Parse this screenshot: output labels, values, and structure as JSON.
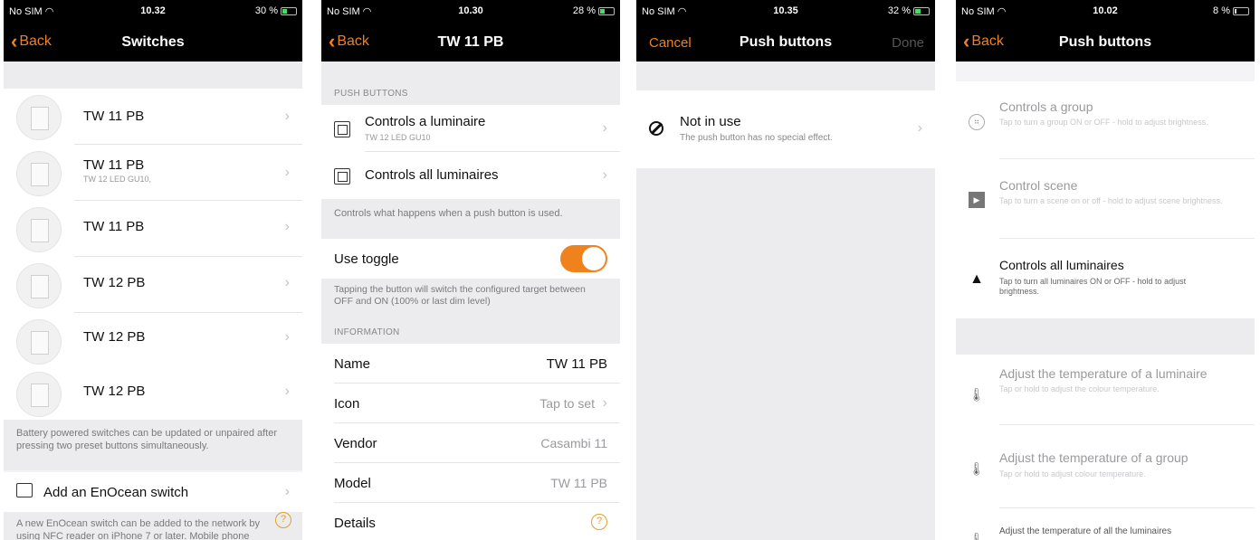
{
  "screens": [
    {
      "status": {
        "carrier": "No SIM",
        "time": "10.32",
        "battery": "30 %"
      },
      "nav": {
        "back": "Back",
        "title": "Switches"
      },
      "switches": [
        {
          "name": "TW 11 PB",
          "sub": ""
        },
        {
          "name": "TW 11 PB",
          "sub": "TW 12 LED GU10,"
        },
        {
          "name": "TW 11 PB",
          "sub": ""
        },
        {
          "name": "TW 12 PB",
          "sub": ""
        },
        {
          "name": "TW 12 PB",
          "sub": ""
        },
        {
          "name": "TW 12 PB",
          "sub": ""
        }
      ],
      "battery_note": "Battery powered switches can be updated or unpaired after pressing two preset buttons simultaneously.",
      "add_label": "Add an EnOcean switch",
      "add_note": "A new EnOcean switch can be added to the network by using NFC reader on iPhone 7 or later. Mobile phone"
    },
    {
      "status": {
        "carrier": "No SIM",
        "time": "10.30",
        "battery": "28 %"
      },
      "nav": {
        "back": "Back",
        "title": "TW 11 PB"
      },
      "push_header": "PUSH BUTTONS",
      "buttons": [
        {
          "label": "Controls a luminaire",
          "sub": "TW 12 LED GU10"
        },
        {
          "label": "Controls all luminaires",
          "sub": ""
        }
      ],
      "buttons_note": "Controls what happens when a push button is used.",
      "toggle_label": "Use toggle",
      "toggle_on": true,
      "toggle_note": "Tapping the button will switch the configured target between OFF and ON (100% or last dim level)",
      "info_header": "INFORMATION",
      "info": [
        {
          "label": "Name",
          "value": "TW 11 PB"
        },
        {
          "label": "Icon",
          "value": "Tap to set"
        },
        {
          "label": "Vendor",
          "value": "Casambi 11"
        },
        {
          "label": "Model",
          "value": "TW 11 PB"
        },
        {
          "label": "Details",
          "value": ""
        }
      ]
    },
    {
      "status": {
        "carrier": "No SIM",
        "time": "10.35",
        "battery": "32 %"
      },
      "nav": {
        "cancel": "Cancel",
        "title": "Push buttons",
        "done": "Done"
      },
      "option": {
        "title": "Not in use",
        "desc": "The push button has no special effect."
      }
    },
    {
      "status": {
        "carrier": "No SIM",
        "time": "10.02",
        "battery": "8 %"
      },
      "nav": {
        "back": "Back",
        "title": "Push buttons"
      },
      "options": [
        {
          "title": "Controls a group",
          "desc": "Tap to turn a group ON or OFF - hold to adjust brightness.",
          "icon": "group-icon"
        },
        {
          "title": "Control scene",
          "desc": "Tap to turn a scene on or off - hold to adjust scene brightness.",
          "icon": "scene-icon"
        },
        {
          "title": "Controls all luminaires",
          "desc": "Tap to turn all luminaires ON or OFF - hold to adjust brightness.",
          "icon": "all-luminaires-icon"
        }
      ],
      "temp_options": [
        {
          "title": "Adjust the temperature of a luminaire",
          "desc": "Tap or hold to adjust the colour temperature.",
          "icon": "thermometer-icon"
        },
        {
          "title": "Adjust the temperature of a group",
          "desc": "Tap or hold to adjust colour temperature.",
          "icon": "thermometer-icon"
        },
        {
          "title": "Adjust the temperature of all the luminaires",
          "desc": "",
          "icon": "thermometer-icon"
        }
      ]
    }
  ]
}
